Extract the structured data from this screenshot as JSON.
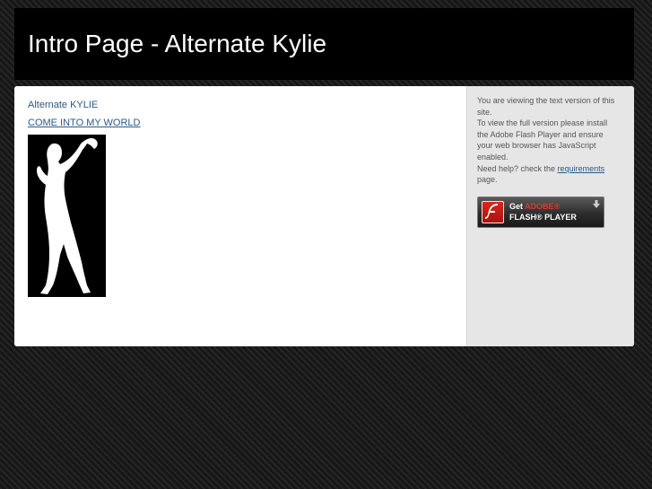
{
  "header": {
    "title": "Intro Page - Alternate Kylie"
  },
  "main": {
    "site_name": "Alternate KYLIE",
    "link_label": "COME INTO MY WORLD",
    "image": "dancer-silhouette-image"
  },
  "sidebar": {
    "notice_line1": "You are viewing the text version of this site.",
    "notice_line2": "To view the full version please install the Adobe Flash Player and ensure your web browser has JavaScript enabled.",
    "help_prefix": "Need help? check the ",
    "help_link": "requirements",
    "help_suffix": " page.",
    "flash_badge": {
      "line1_get": "Get ",
      "line1_adobe": "ADOBE",
      "line1_mark": "®",
      "line2": "FLASH",
      "line2_mark": "®",
      "line2_rest": " PLAYER",
      "arrow_icon": "download-arrow-icon",
      "logo_icon": "flash-logo-icon"
    }
  },
  "colors": {
    "link": "#2a5a85",
    "header_bg": "#000000",
    "sidebar_bg": "#e6e6e6",
    "adobe_red": "#e03a2c"
  }
}
